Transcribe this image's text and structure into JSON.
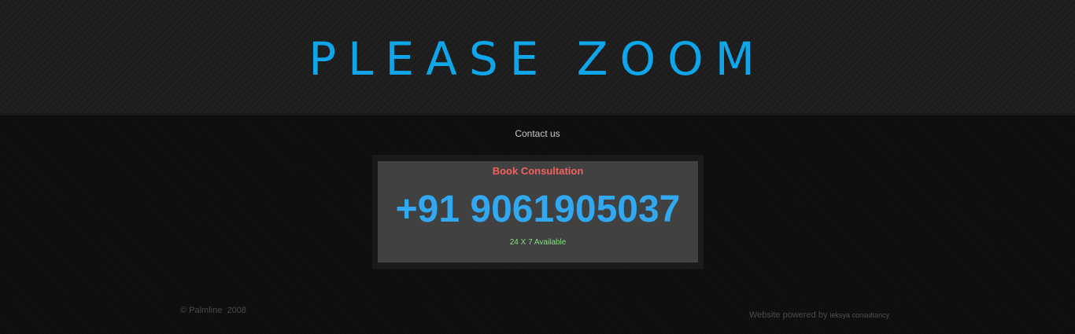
{
  "header": {
    "logo_text": "PLEASE ZOOM"
  },
  "nav": {
    "contact_label": "Contact us"
  },
  "consultation": {
    "title": "Book Consultation",
    "phone": "+91 9061905037",
    "availability": "24 X 7 Available"
  },
  "footer": {
    "copyright": "© Palmline  2008",
    "powered_prefix": "Website powered by ",
    "powered_company": "leksya consultancy"
  },
  "colors": {
    "logo": "#0ea5e9",
    "phone": "#31a8f0",
    "title": "#f26060",
    "availability": "#7fe07f"
  }
}
